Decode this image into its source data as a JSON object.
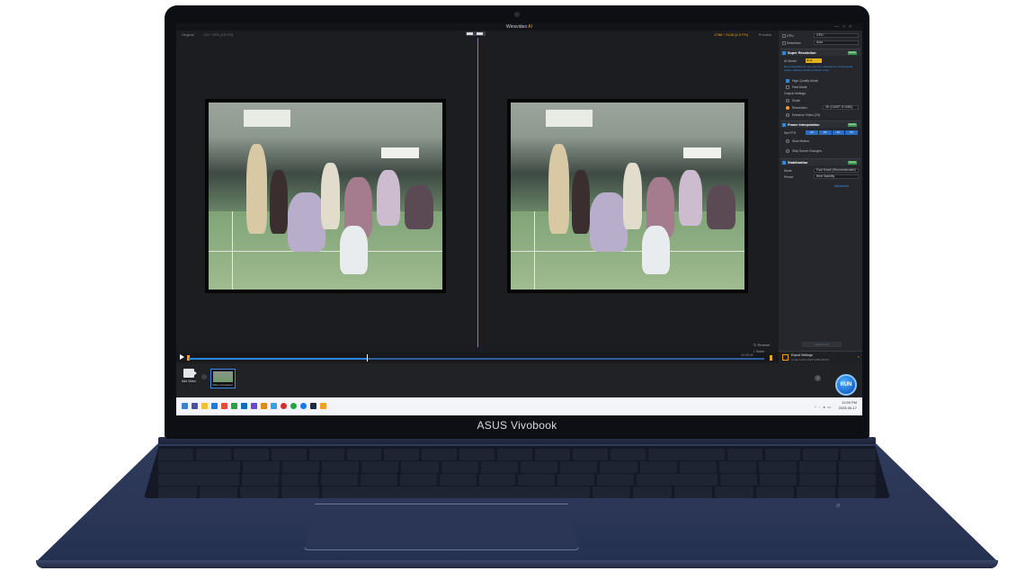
{
  "laptop": {
    "brand": "ASUS Vivobook"
  },
  "app": {
    "title": "Winxvideo",
    "title_ai": "AI"
  },
  "preview": {
    "original_label": "Original",
    "original_size": "720 * 576 (4:3 PH)",
    "output_size": "2786 * 2128 (4:3 PH)",
    "preview_label": "Preview",
    "restore_label": "Restore",
    "save_label": "Save"
  },
  "timeline": {
    "time": "00:35:49"
  },
  "sidebar": {
    "gpu_label": "GPU",
    "gpu_value": "GPU",
    "seamless_label": "Seamless",
    "seamless_value": "Auto",
    "super_resolution": "Super Resolution",
    "enabled_badge": "Enable",
    "ai_model_label": "AI Model",
    "ai_model_value": "Real-ESRGAN",
    "model_note": "Recommended for old, low-res, interlaced or compressed videos. Restore detail, enhance color.",
    "high_quality": "High Quality Mode",
    "fast_mode": "Fast Mode",
    "output_settings": "Output Settings",
    "scale_label": "Scale",
    "resolution_label": "Resolution",
    "resolution_value": "4K (2160P, 8:1080)",
    "custom_label": "Enhance Video (2X)",
    "frame_interpolation": "Frame Interpolation",
    "fps_label": "Set FPS",
    "fps_options": [
      "2X",
      "3X",
      "4X",
      "5X"
    ],
    "slow_motion": "Slow Motion",
    "skip_frames": "Skip Scene Changes",
    "stabilization": "Stabilization",
    "mode_label": "Mode",
    "mode_value": "Fast Mode (Recommended)",
    "preset_label": "Preset",
    "preset_value": "Best Stability",
    "advanced": "Advanced",
    "apply_all": "Apply to All",
    "export_title": "Export Settings",
    "export_sub": "Codec:H264 1920*1080 30FPS"
  },
  "strip": {
    "add_video": "Add Video",
    "clip_name": "Video Compared",
    "run": "RUN",
    "help": "?"
  },
  "tray": {
    "time": "11:59 PM",
    "date": "2025-06-17"
  },
  "colors": {
    "accent": "#2b86e0",
    "highlight": "#f0a020",
    "run": "#1666c9"
  },
  "progress": {
    "timeline_fraction": 0.31
  }
}
